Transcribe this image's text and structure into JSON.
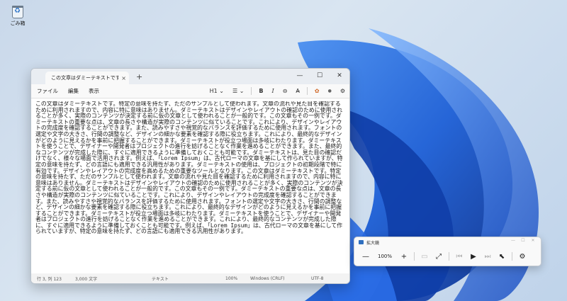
{
  "desktop": {
    "recycle_bin_label": "ごみ箱"
  },
  "notepad": {
    "tab_title": "この文章はダミーテキストです。特定の意味",
    "tab_close": "×",
    "tab_add": "+",
    "window_controls": {
      "minimize": "—",
      "maximize": "☐",
      "close": "✕"
    },
    "menu": {
      "file": "ファイル",
      "edit": "編集",
      "view": "表示"
    },
    "toolbar": {
      "heading": "H1 ⌄",
      "list": "☰ ⌄",
      "bold": "B",
      "italic": "I",
      "link": "⊖",
      "clear_format": "A̶",
      "copilot": "✿",
      "account": "●",
      "settings": "⚙"
    },
    "body": "この文章はダミーテキストです。特定の意味を持たず、ただのサンプルとして使われます。文章の流れや見た目を確認するために利用されますので、内容に特に意味はありません。ダミーテキストはデザインやレイアウトの確認のために使用されることが多く、実際のコンテンツが決定する前に仮の文章として使われることが一般的です。この文章もその一例です。ダミーテキストの重要な点は、文章の長さや構造が実際のコンテンツに似ていることです。これにより、デザインやレイアウトの完成度を確認することができます。また、読みやすさや視覚的なバランスを評価するために使用されます。フォントの選定や文字の大きさ、行間の調整など、デザインの細かな要素を確認する際に役立ちます。これにより、最終的なデザインがどのように見えるかを事前に把握することができます。ダミーテキストが役立つ場面は多岐にわたります。ダミーテキストを使うことで、デザイナーや開発者はプロジェクトの進行を妨げることなく作業を進めることができます。また、最終的なコンテンツが完成した際に、すぐに適用できるように準備しておくことも可能です。ダミーテキストは、見た目の確認だけでなく、様々な場面で活用されます。例えば、「Lorem Ipsum」は、古代ローマの文章を基にして作られていますが、特定の意味を持たず、どの言語にも適用できる汎用性があります。ダミーテキストの使用は、プロジェクトの初期段階で特に有効です。デザインやレイアウトの完成度を高めるための重要なツールとなります。この文章はダミーテキストです。特定の意味を持たず、ただのサンプルとして使われます。文章の流れや見た目を確認するために利用されますので、内容に特に意味はありません。ダミーテキストはデザインやレイアウトの確認のために使用されることが多く、実際のコンテンツが決定する前に仮の文章として使われることが一般的です。この文章もその一例です。ダミーテキストの重要な点は、文章の長さや構造が実際のコンテンツに似ていることです。これにより、デザインやレイアウトの完成度を確認することができます。また、読みやすさや視覚的なバランスを評価するために使用されます。フォントの選定や文字の大きさ、行間の調整など、デザインの細かな要素を確認する際に役立ちます。これにより、最終的なデザインがどのように見えるかを事前に把握することができます。ダミーテキストが役立つ場面は多岐にわたります。ダミーテキストを使うことで、デザイナーや開発者はプロジェクトの進行を妨げることなく作業を進めることができます。これにより、最終的なコンテンツが完成した際に、すぐに適用できるように準備しておくことも可能です。例えば、「Lorem Ipsum」は、古代ローマの文章を基にして作られていますが、特定の意味を持たず、どの言語にも適用できる汎用性があります。",
    "status": {
      "position": "行 3, 列 123",
      "chars": "3,000 文字",
      "format": "テキスト",
      "zoom": "100%",
      "line_ending": "Windows (CRLF)",
      "encoding": "UTF-8"
    }
  },
  "magnifier": {
    "title": "拡大鏡",
    "zoom_out": "—",
    "zoom_level": "100%",
    "zoom_in": "+",
    "view_mode": "▭",
    "expand": "⤢",
    "prev": "⏮",
    "play": "▶",
    "next": "⏭",
    "read_from": "⬉",
    "settings": "⚙",
    "window_controls": {
      "minimize": "—",
      "maximize": "☐",
      "close": "✕"
    }
  }
}
